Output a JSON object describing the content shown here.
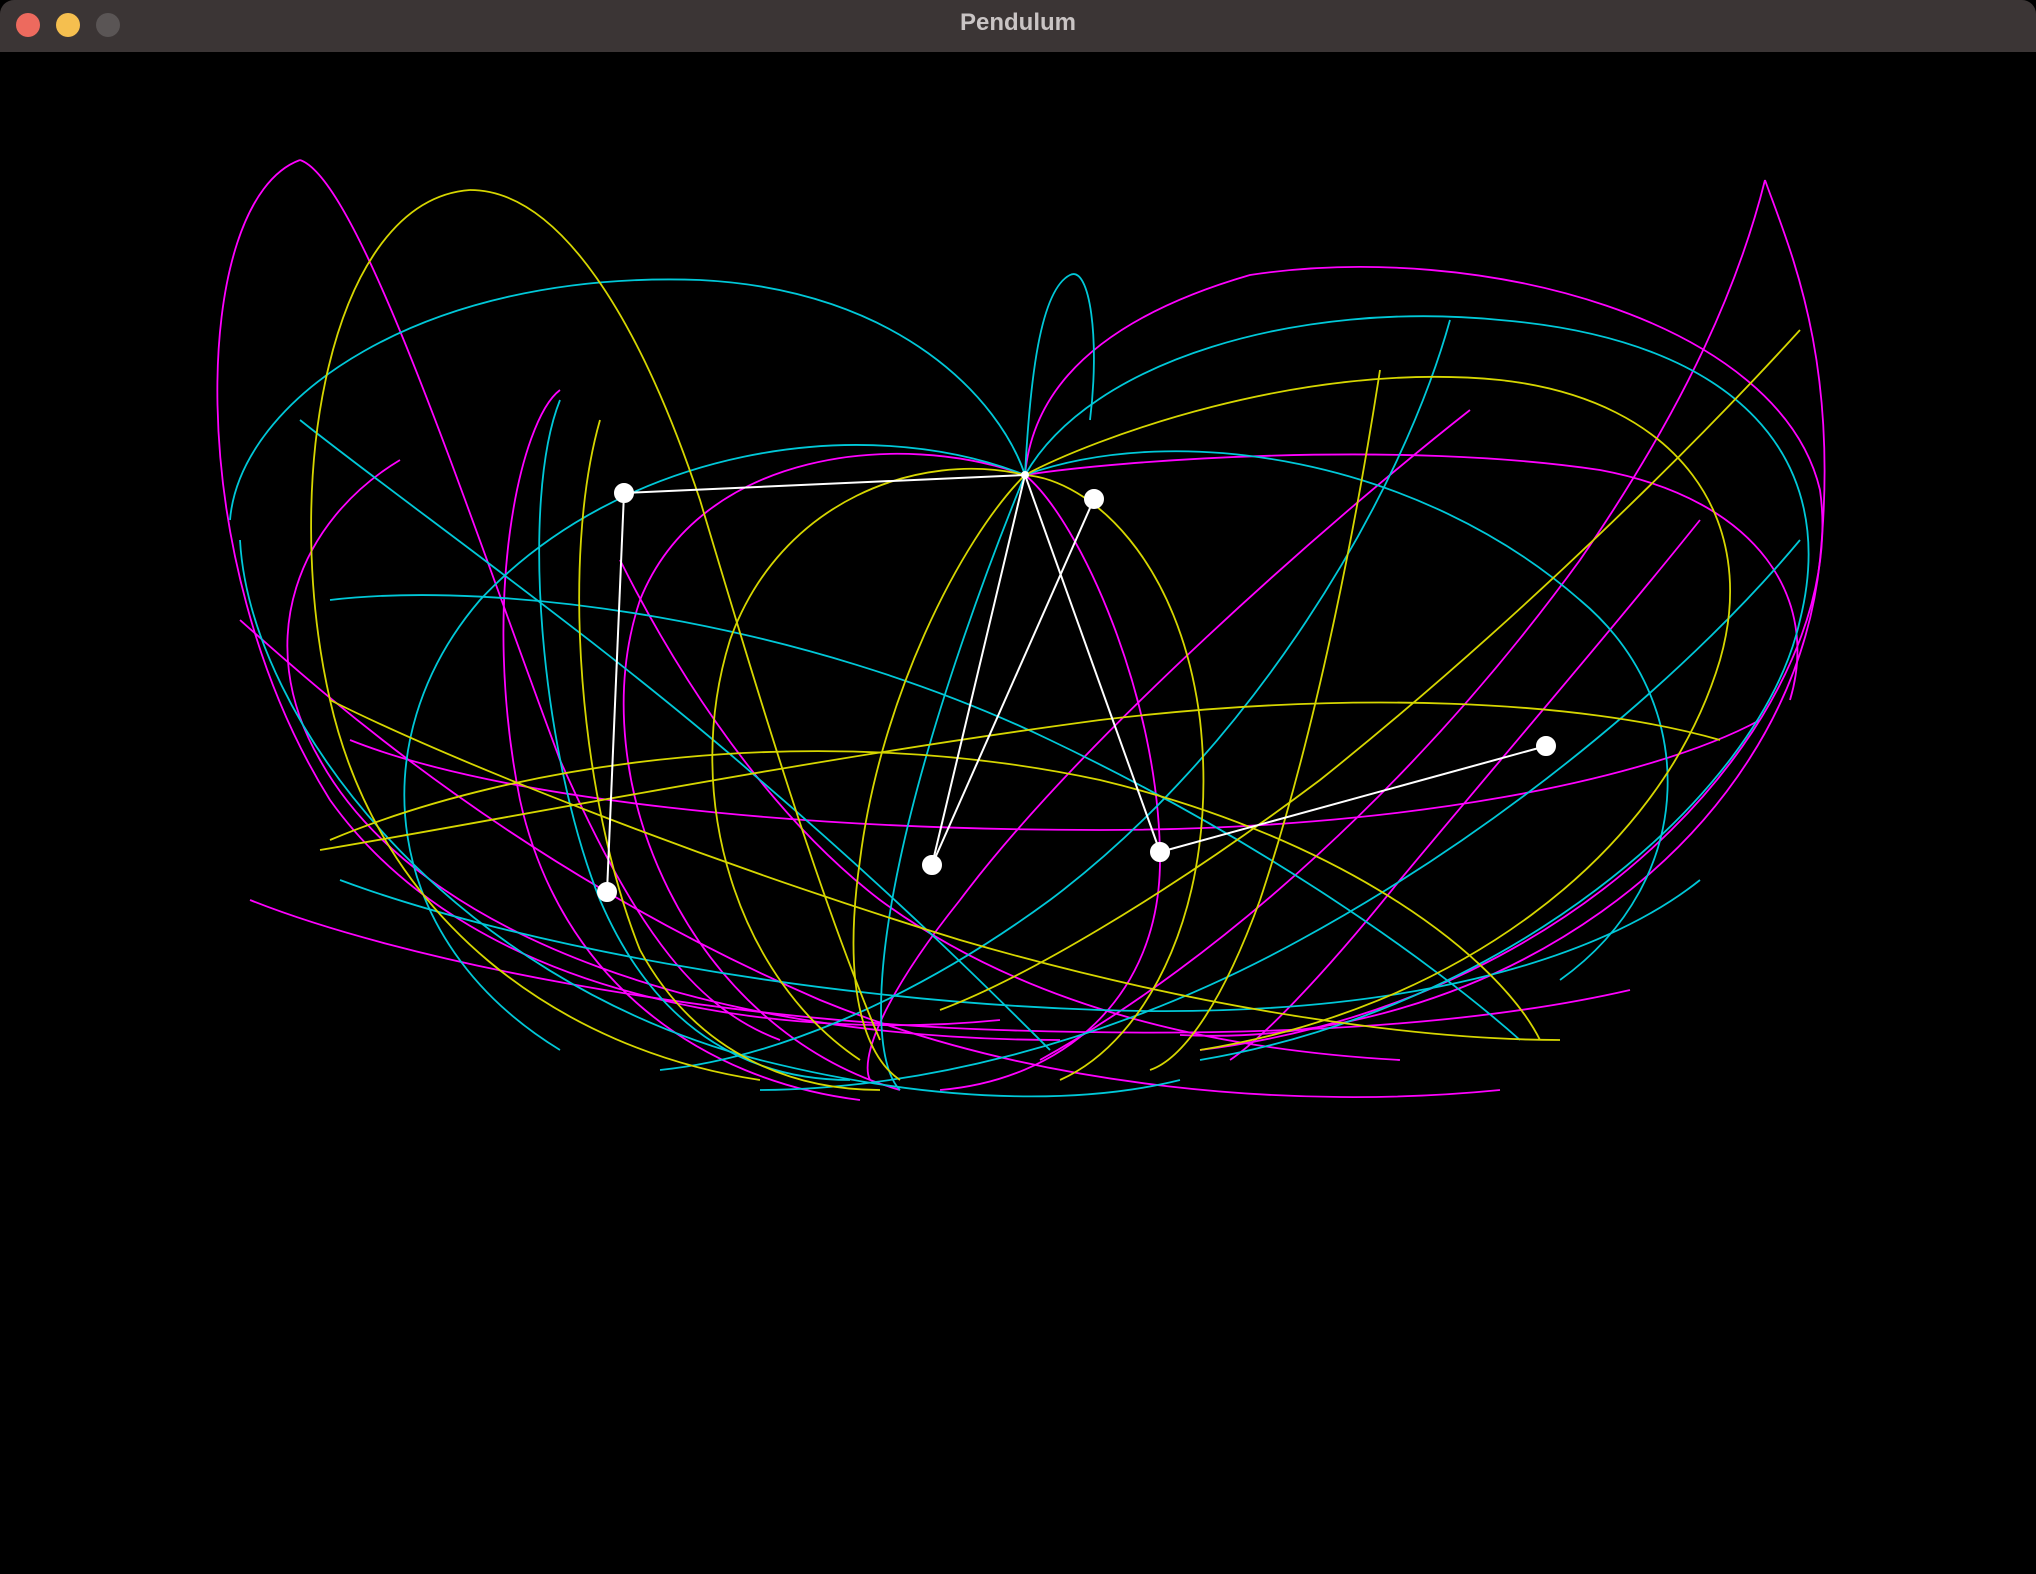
{
  "window": {
    "title": "Pendulum",
    "controls": {
      "close_color": "#ed6a5e",
      "minimize_color": "#f5bf4f",
      "zoom_color": "#5a5555"
    }
  },
  "simulation": {
    "background": "#000000",
    "pendulum_color": "#ffffff",
    "trail_colors": {
      "magenta": "#ff00ff",
      "cyan": "#00c8d8",
      "yellow": "#d6d600"
    },
    "pendulums": [
      {
        "name": "pendulum-1",
        "trail": "cyan"
      },
      {
        "name": "pendulum-2",
        "trail": "yellow"
      },
      {
        "name": "pendulum-3",
        "trail": "magenta"
      }
    ]
  }
}
